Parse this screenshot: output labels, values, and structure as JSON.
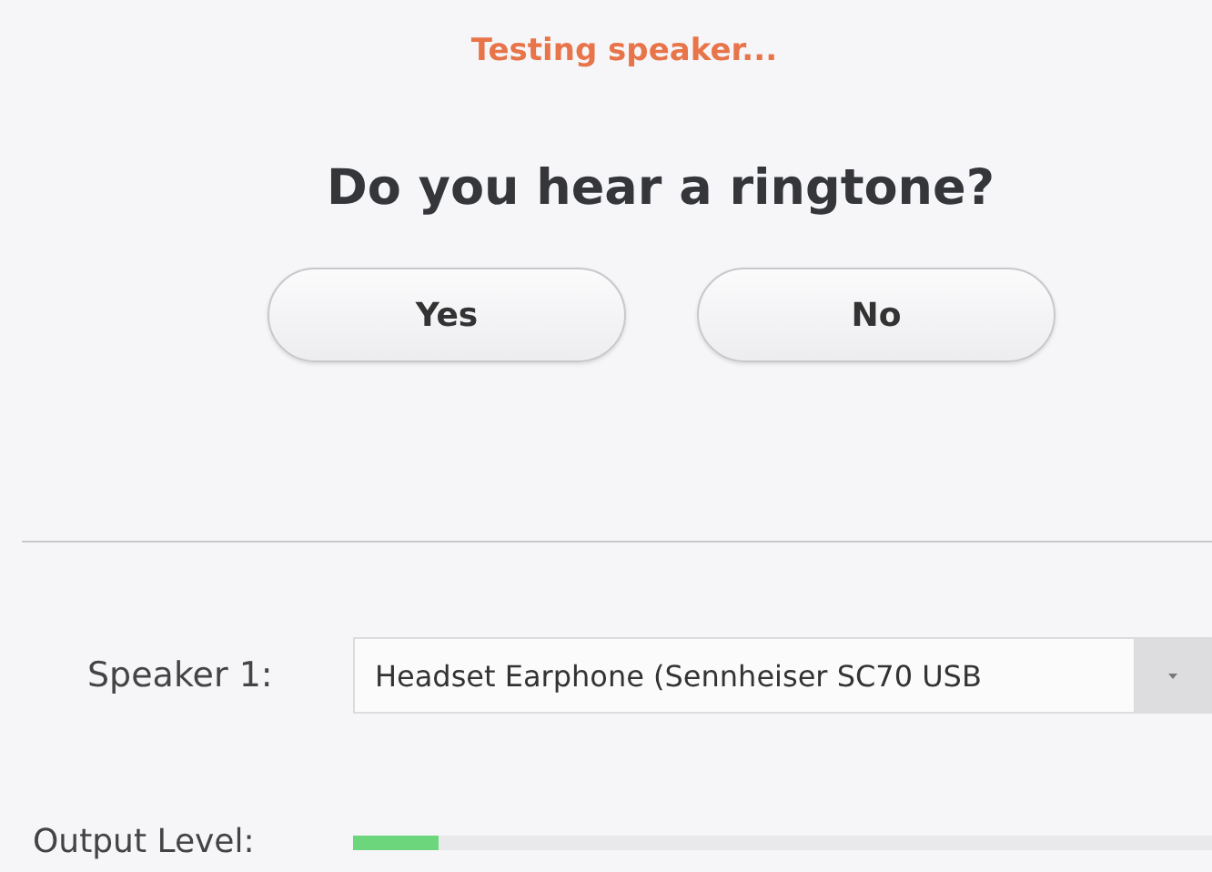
{
  "status": "Testing speaker...",
  "question": "Do you hear a ringtone?",
  "buttons": [
    {
      "label": "Yes"
    },
    {
      "label": "No"
    }
  ],
  "speaker": {
    "label": "Speaker 1:",
    "value": "Headset Earphone (Sennheiser SC70 USB"
  },
  "output": {
    "label": "Output Level:",
    "level": 0.1
  }
}
